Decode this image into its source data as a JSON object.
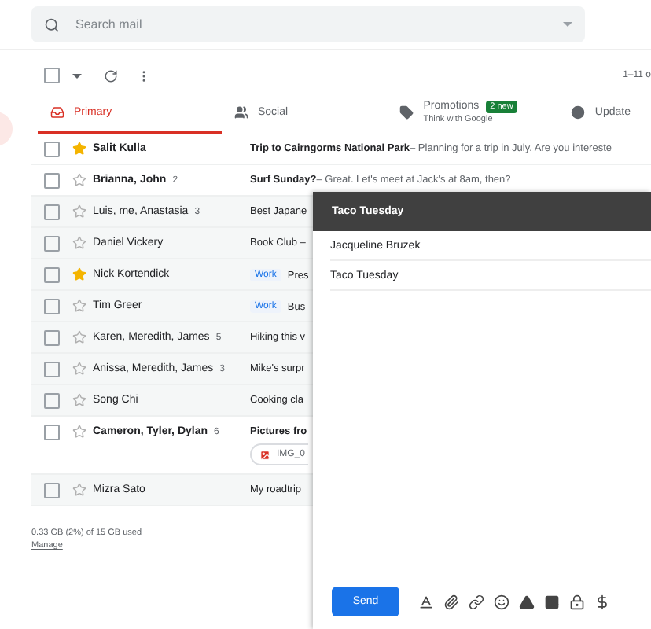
{
  "search": {
    "placeholder": "Search mail"
  },
  "toolbar": {
    "select_all_checked": false,
    "range": "1–11 o"
  },
  "tabs": [
    {
      "kind": "inbox",
      "label": "Primary",
      "selected": true
    },
    {
      "kind": "social",
      "label": "Social",
      "selected": false
    },
    {
      "kind": "promotions",
      "label": "Promotions",
      "badge": "2 new",
      "subtitle": "Think with Google",
      "selected": false
    },
    {
      "kind": "updates",
      "label": "Update",
      "selected": false
    }
  ],
  "rows": [
    {
      "sender": "Salit Kulla",
      "starred": true,
      "unread": true,
      "subject": "Trip to Cairngorms National Park",
      "snippet": " – Planning for a trip in July. Are you intereste"
    },
    {
      "sender": "Brianna, John",
      "count": "2",
      "starred": false,
      "unread": true,
      "subject": "Surf Sunday?",
      "snippet": "– Great. Let's meet at Jack's at 8am, then?"
    },
    {
      "sender": "Luis, me, Anastasia",
      "count": "3",
      "starred": false,
      "unread": false,
      "subject": "Best Japane"
    },
    {
      "sender": "Daniel Vickery",
      "starred": false,
      "unread": false,
      "subject": "Book Club –"
    },
    {
      "sender": "Nick Kortendick",
      "starred": true,
      "unread": false,
      "label": "Work",
      "subject": "Pres"
    },
    {
      "sender": "Tim Greer",
      "starred": false,
      "unread": false,
      "label": "Work",
      "subject": "Bus"
    },
    {
      "sender": "Karen, Meredith, James",
      "count": "5",
      "starred": false,
      "unread": false,
      "subject": "Hiking this v"
    },
    {
      "sender": "Anissa, Meredith, James",
      "count": "3",
      "starred": false,
      "unread": false,
      "subject": "Mike's surpr"
    },
    {
      "sender": "Song Chi",
      "starred": false,
      "unread": false,
      "subject": "Cooking cla"
    },
    {
      "sender": "Cameron, **Tyler, Dylan**",
      "count": "6",
      "starred": false,
      "unread": true,
      "subject": "Pictures fro",
      "attachment": "IMG_0"
    },
    {
      "sender": "Mizra Sato",
      "starred": false,
      "unread": false,
      "subject": "My roadtrip"
    }
  ],
  "storage": {
    "usage": "0.33 GB (2%) of 15 GB used",
    "link": "Manage"
  },
  "compose": {
    "title": "Taco Tuesday",
    "to": "Jacqueline Bruzek",
    "subject": "Taco Tuesday",
    "send": "Send"
  }
}
